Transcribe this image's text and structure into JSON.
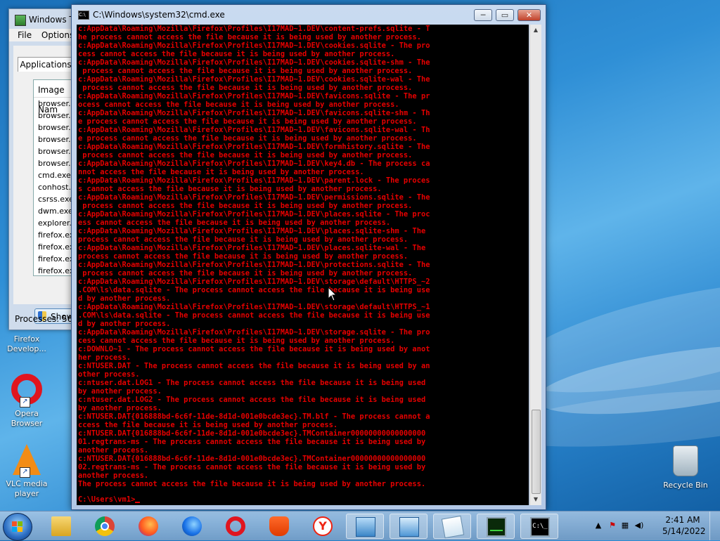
{
  "desktop": {
    "icons": [
      {
        "label": "Firefox Develop..."
      },
      {
        "label": "Opera Browser"
      },
      {
        "label": "VLC media player"
      },
      {
        "label": "Recycle Bin"
      }
    ]
  },
  "task_manager": {
    "title": "Windows T",
    "menu": [
      "File",
      "Options"
    ],
    "tab": "Applications",
    "column_header": "Image Nam",
    "processes": [
      "browser.ex",
      "browser.ex",
      "browser.ex",
      "browser.ex",
      "browser.ex",
      "browser.ex",
      "cmd.exe",
      "conhost.ex",
      "csrss.exe",
      "dwm.exe",
      "explorer.ex",
      "firefox.exe",
      "firefox.exe",
      "firefox.exe",
      "firefox.exe"
    ],
    "show_button": "Show p",
    "status": "Processes: 56"
  },
  "cmd": {
    "title": "C:\\Windows\\system32\\cmd.exe",
    "buttons": {
      "min": "─",
      "max": "▭",
      "close": "✕"
    },
    "lines": [
      "c:AppData\\Roaming\\Mozilla\\Firefox\\Profiles\\I17MAD~1.DEV\\content-prefs.sqlite - T",
      "he process cannot access the file because it is being used by another process.",
      "c:AppData\\Roaming\\Mozilla\\Firefox\\Profiles\\I17MAD~1.DEV\\cookies.sqlite - The pro",
      "cess cannot access the file because it is being used by another process.",
      "c:AppData\\Roaming\\Mozilla\\Firefox\\Profiles\\I17MAD~1.DEV\\cookies.sqlite-shm - The",
      " process cannot access the file because it is being used by another process.",
      "c:AppData\\Roaming\\Mozilla\\Firefox\\Profiles\\I17MAD~1.DEV\\cookies.sqlite-wal - The",
      " process cannot access the file because it is being used by another process.",
      "c:AppData\\Roaming\\Mozilla\\Firefox\\Profiles\\I17MAD~1.DEV\\favicons.sqlite - The pr",
      "ocess cannot access the file because it is being used by another process.",
      "c:AppData\\Roaming\\Mozilla\\Firefox\\Profiles\\I17MAD~1.DEV\\favicons.sqlite-shm - Th",
      "e process cannot access the file because it is being used by another process.",
      "c:AppData\\Roaming\\Mozilla\\Firefox\\Profiles\\I17MAD~1.DEV\\favicons.sqlite-wal - Th",
      "e process cannot access the file because it is being used by another process.",
      "c:AppData\\Roaming\\Mozilla\\Firefox\\Profiles\\I17MAD~1.DEV\\formhistory.sqlite - The",
      " process cannot access the file because it is being used by another process.",
      "c:AppData\\Roaming\\Mozilla\\Firefox\\Profiles\\I17MAD~1.DEV\\key4.db - The process ca",
      "nnot access the file because it is being used by another process.",
      "c:AppData\\Roaming\\Mozilla\\Firefox\\Profiles\\I17MAD~1.DEV\\parent.lock - The proces",
      "s cannot access the file because it is being used by another process.",
      "c:AppData\\Roaming\\Mozilla\\Firefox\\Profiles\\I17MAD~1.DEV\\permissions.sqlite - The",
      " process cannot access the file because it is being used by another process.",
      "c:AppData\\Roaming\\Mozilla\\Firefox\\Profiles\\I17MAD~1.DEV\\places.sqlite - The proc",
      "ess cannot access the file because it is being used by another process.",
      "c:AppData\\Roaming\\Mozilla\\Firefox\\Profiles\\I17MAD~1.DEV\\places.sqlite-shm - The",
      "process cannot access the file because it is being used by another process.",
      "c:AppData\\Roaming\\Mozilla\\Firefox\\Profiles\\I17MAD~1.DEV\\places.sqlite-wal - The",
      "process cannot access the file because it is being used by another process.",
      "c:AppData\\Roaming\\Mozilla\\Firefox\\Profiles\\I17MAD~1.DEV\\protections.sqlite - The",
      " process cannot access the file because it is being used by another process.",
      "c:AppData\\Roaming\\Mozilla\\Firefox\\Profiles\\I17MAD~1.DEV\\storage\\default\\HTTPS_~2",
      ".COM\\ls\\data.sqlite - The process cannot access the file because it is being use",
      "d by another process.",
      "c:AppData\\Roaming\\Mozilla\\Firefox\\Profiles\\I17MAD~1.DEV\\storage\\default\\HTTPS_~1",
      ".COM\\ls\\data.sqlite - The process cannot access the file because it is being use",
      "d by another process.",
      "c:AppData\\Roaming\\Mozilla\\Firefox\\Profiles\\I17MAD~1.DEV\\storage.sqlite - The pro",
      "cess cannot access the file because it is being used by another process.",
      "c:DOWNLO~1 - The process cannot access the file because it is being used by anot",
      "her process.",
      "c:NTUSER.DAT - The process cannot access the file because it is being used by an",
      "other process.",
      "c:ntuser.dat.LOG1 - The process cannot access the file because it is being used",
      "by another process.",
      "c:ntuser.dat.LOG2 - The process cannot access the file because it is being used",
      "by another process.",
      "c:NTUSER.DAT{016888bd-6c6f-11de-8d1d-001e0bcde3ec}.TM.blf - The process cannot a",
      "ccess the file because it is being used by another process.",
      "c:NTUSER.DAT{016888bd-6c6f-11de-8d1d-001e0bcde3ec}.TMContainer00000000000000000",
      "01.regtrans-ms - The process cannot access the file because it is being used by",
      "another process.",
      "c:NTUSER.DAT{016888bd-6c6f-11de-8d1d-001e0bcde3ec}.TMContainer00000000000000000",
      "02.regtrans-ms - The process cannot access the file because it is being used by",
      "another process.",
      "The process cannot access the file because it is being used by another process."
    ],
    "prompt": "C:\\Users\\vm1>"
  },
  "taskbar": {
    "apps": [
      "explorer",
      "chrome",
      "firefox",
      "firefox-developer",
      "opera",
      "brave",
      "yandex",
      "control-panel",
      "remote-desktop",
      "notepad",
      "task-manager",
      "cmd"
    ],
    "clock_time": "2:41 AM",
    "clock_date": "5/14/2022"
  }
}
